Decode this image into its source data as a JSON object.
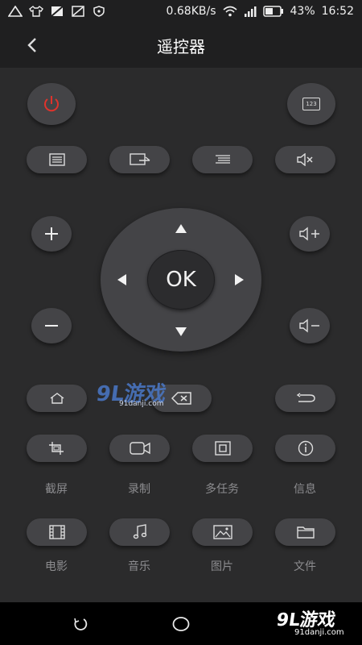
{
  "status_bar": {
    "net_speed": "0.68KB/s",
    "battery": "43%",
    "time": "16:52"
  },
  "header": {
    "title": "遥控器",
    "back_icon": "chevron-left-icon"
  },
  "buttons": {
    "numeric_badge": "123",
    "ok": "OK"
  },
  "function_labels": [
    "截屏",
    "录制",
    "多任务",
    "信息"
  ],
  "media_labels": [
    "电影",
    "音乐",
    "图片",
    "文件"
  ],
  "watermark": {
    "logo_text": "9L游戏",
    "domain": "91danji.com"
  },
  "colors": {
    "power_accent": "#e0332c",
    "button_bg": "#444447",
    "background": "#2b2b2c"
  }
}
